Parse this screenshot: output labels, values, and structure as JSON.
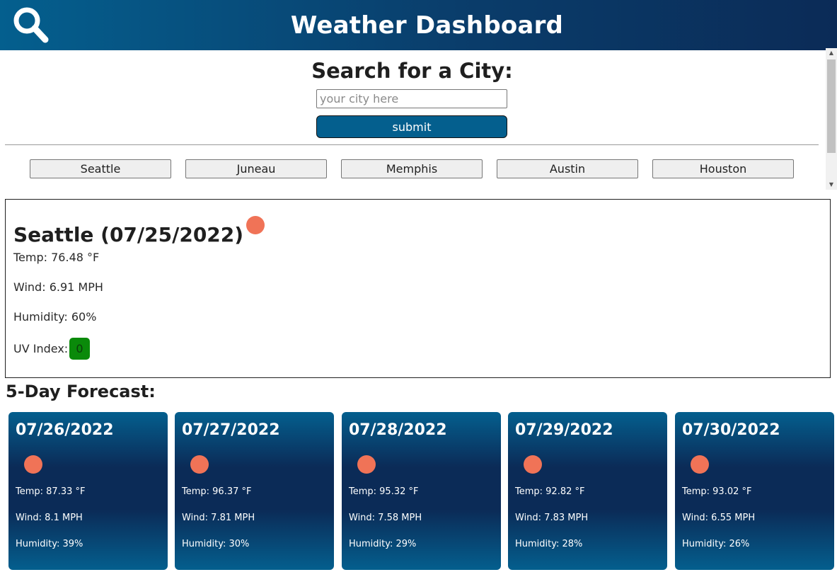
{
  "header": {
    "title": "Weather Dashboard",
    "logo_icon": "magnifier-icon"
  },
  "search": {
    "title": "Search for a City:",
    "input_placeholder": "your city here",
    "input_value": "",
    "submit_label": "submit"
  },
  "history": [
    "Seattle",
    "Juneau",
    "Memphis",
    "Austin",
    "Houston"
  ],
  "current": {
    "heading": "Seattle (07/25/2022)",
    "temp": "Temp: 76.48 °F",
    "wind": "Wind: 6.91 MPH",
    "humidity": "Humidity: 60%",
    "uv_label": "UV Index:",
    "uv_value": "0",
    "uv_color": "#0a8a0a",
    "icon": "sun-icon"
  },
  "forecast": {
    "title": "5-Day Forecast:",
    "days": [
      {
        "date": "07/26/2022",
        "temp": "Temp: 87.33 °F",
        "wind": "Wind: 8.1 MPH",
        "humidity": "Humidity: 39%"
      },
      {
        "date": "07/27/2022",
        "temp": "Temp: 96.37 °F",
        "wind": "Wind: 7.81 MPH",
        "humidity": "Humidity: 30%"
      },
      {
        "date": "07/28/2022",
        "temp": "Temp: 95.32 °F",
        "wind": "Wind: 7.58 MPH",
        "humidity": "Humidity: 29%"
      },
      {
        "date": "07/29/2022",
        "temp": "Temp: 92.82 °F",
        "wind": "Wind: 7.83 MPH",
        "humidity": "Humidity: 28%"
      },
      {
        "date": "07/30/2022",
        "temp": "Temp: 93.02 °F",
        "wind": "Wind: 6.55 MPH",
        "humidity": "Humidity: 26%"
      }
    ]
  },
  "colors": {
    "brand_blue": "#045f8e",
    "brand_navy": "#0b2b57",
    "sun": "#f07357"
  }
}
